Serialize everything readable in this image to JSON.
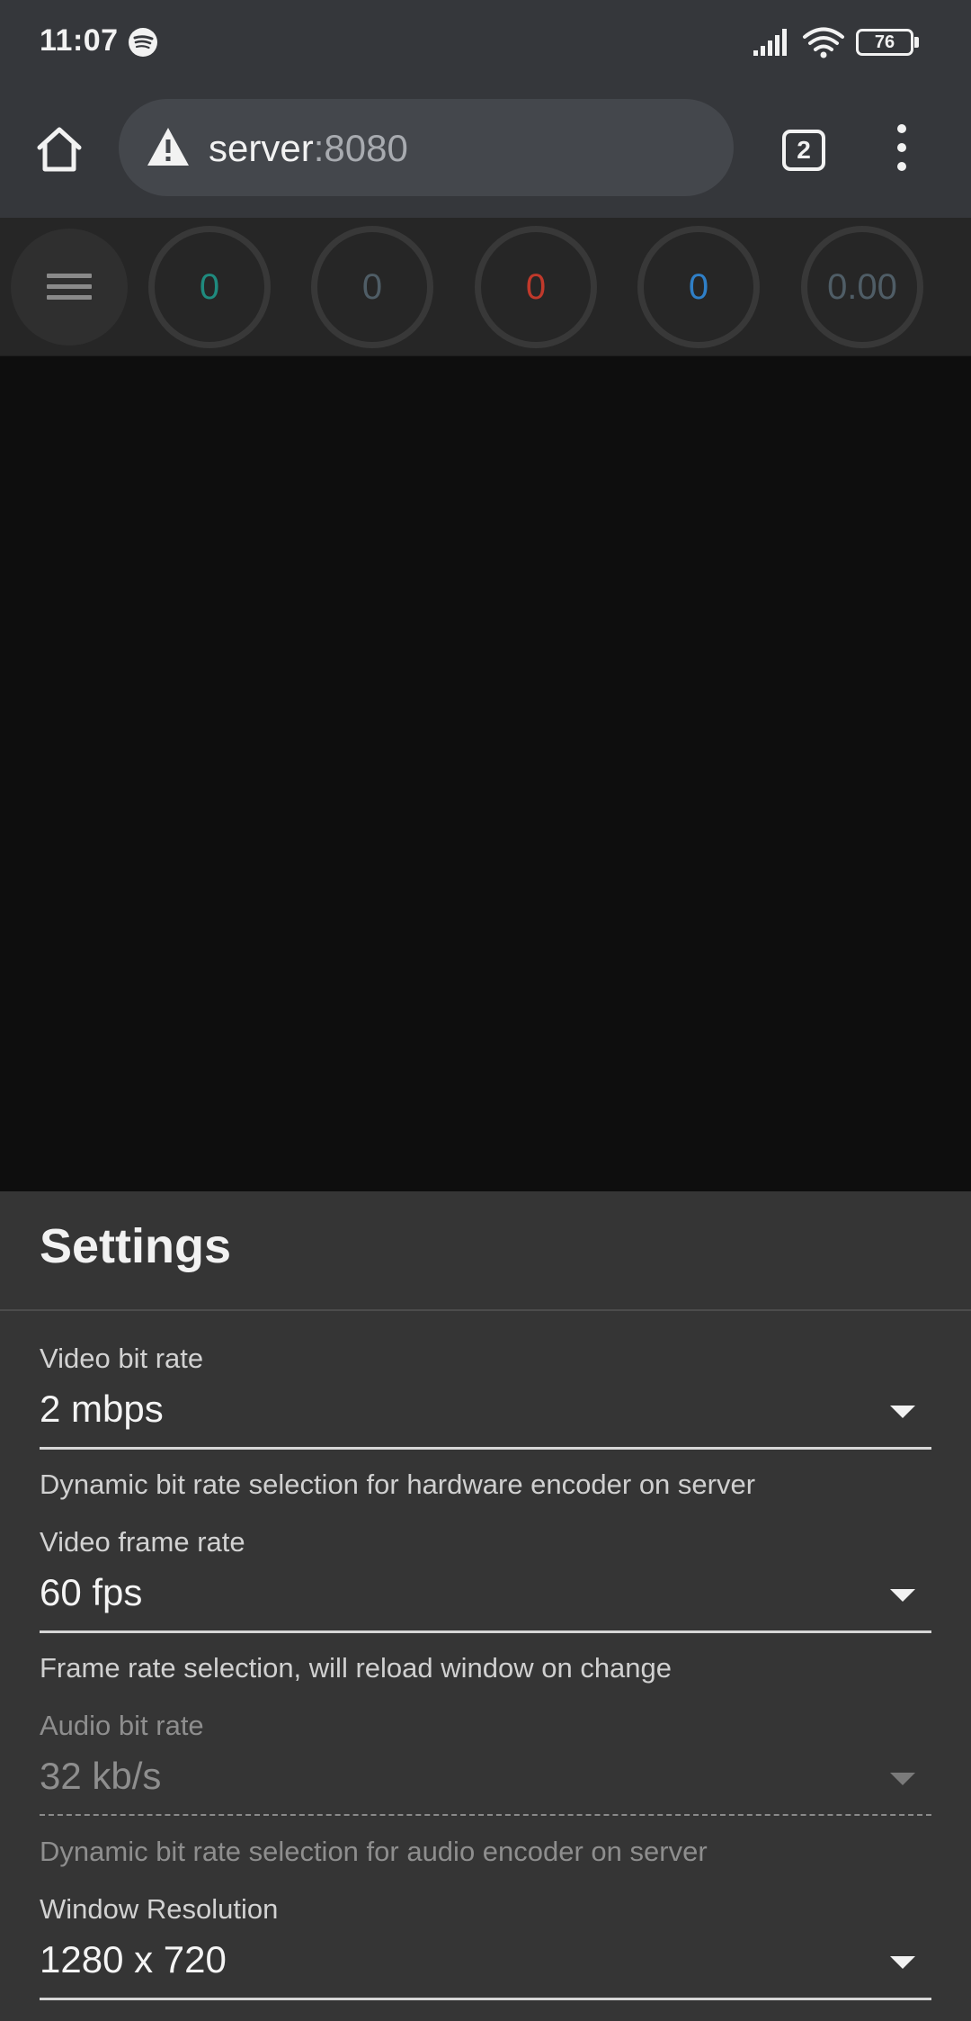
{
  "status_bar": {
    "time": "11:07",
    "battery_level": "76",
    "icons": [
      "spotify-icon",
      "signal-icon",
      "wifi-icon",
      "battery-icon"
    ]
  },
  "browser": {
    "url_host": "server",
    "url_port": ":8080",
    "tab_count": "2",
    "icons": [
      "home-icon",
      "warning-icon",
      "tabs-icon",
      "more-vert-icon"
    ]
  },
  "stats": [
    {
      "value": "0",
      "color": "#1f8a7e"
    },
    {
      "value": "0",
      "color": "#4f5d66"
    },
    {
      "value": "0",
      "color": "#c0392b"
    },
    {
      "value": "0",
      "color": "#2f7fc7"
    },
    {
      "value": "0.00",
      "color": "#4f5d66"
    }
  ],
  "settings": {
    "title": "Settings",
    "fields": [
      {
        "label": "Video bit rate",
        "value": "2 mbps",
        "help": "Dynamic bit rate selection for hardware encoder on server",
        "disabled": false
      },
      {
        "label": "Video frame rate",
        "value": "60 fps",
        "help": "Frame rate selection, will reload window on change",
        "disabled": false
      },
      {
        "label": "Audio bit rate",
        "value": "32 kb/s",
        "help": "Dynamic bit rate selection for audio encoder on server",
        "disabled": true
      },
      {
        "label": "Window Resolution",
        "value": "1280 x 720",
        "help": "",
        "disabled": false
      }
    ]
  }
}
